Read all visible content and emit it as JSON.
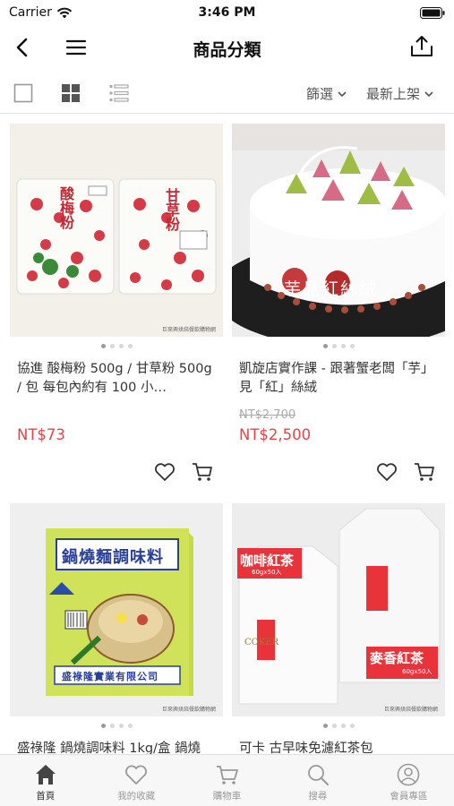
{
  "status_bar": {
    "carrier": "Carrier",
    "time": "3:46 PM"
  },
  "nav": {
    "title": "商品分類"
  },
  "toolbar": {
    "filter_label": "篩選",
    "sort_label": "最新上架"
  },
  "products": [
    {
      "name": "協進 酸梅粉 500g / 甘草粉 500g / 包 每包內約有 100 小…",
      "old_price": "",
      "price": "NT$73",
      "dots": 4,
      "active_dot": 0,
      "image_text": {
        "left_bag": "酸梅粉",
        "right_bag": "甘草粉",
        "watermark": "巨來興烘焙餐飲購物網"
      }
    },
    {
      "name": "凱旋店實作課 - 跟著蟹老闆「芋」見「紅」絲絨",
      "old_price": "NT$2,700",
      "price": "NT$2,500",
      "dots": 4,
      "active_dot": 0,
      "image_text": {
        "overlay": "芋見紅絲絨"
      }
    },
    {
      "name": "盛祿隆 鍋燒調味料 1kg/盒 鍋燒",
      "old_price": "",
      "price": "",
      "dots": 4,
      "active_dot": 0,
      "image_text": {
        "label": "鍋燒麵調味料",
        "maker": "盛祿隆實業有限公司",
        "watermark": "巨來興烘焙餐飲購物網"
      }
    },
    {
      "name": "可卡 古早味免濾紅茶包",
      "old_price": "",
      "price": "",
      "dots": 4,
      "active_dot": 0,
      "image_text": {
        "left_tag": "咖啡紅茶",
        "left_sub": "60gx50入",
        "right_tag": "麥香紅茶",
        "right_sub": "60gx50入",
        "brand": "COKER",
        "watermark": "巨來興烘焙餐飲購物網"
      }
    }
  ],
  "tabs": [
    {
      "label": "首頁",
      "icon": "home-icon",
      "active": true
    },
    {
      "label": "我的收藏",
      "icon": "heart-icon",
      "active": false
    },
    {
      "label": "購物車",
      "icon": "cart-icon",
      "active": false
    },
    {
      "label": "搜尋",
      "icon": "search-icon",
      "active": false
    },
    {
      "label": "會員專區",
      "icon": "user-icon",
      "active": false
    }
  ],
  "colors": {
    "price": "#e8434a",
    "tab_active": "#333333",
    "tab_inactive": "#999999"
  }
}
